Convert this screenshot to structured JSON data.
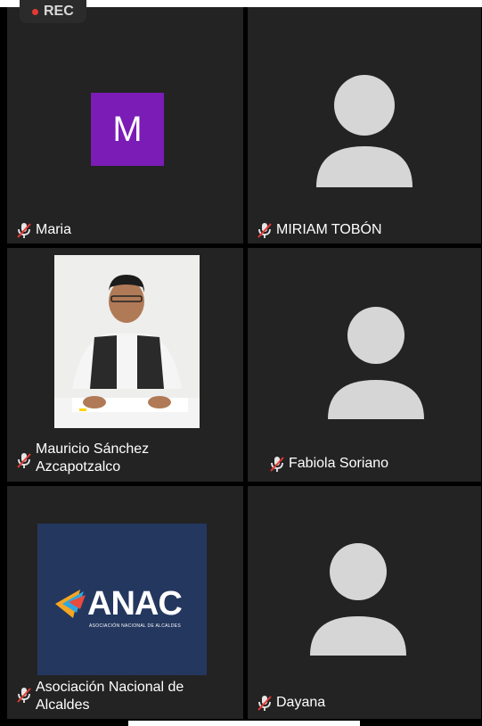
{
  "recording": {
    "label": "REC"
  },
  "participants": [
    {
      "name": "Maria",
      "avatar_letter": "M",
      "avatar_color": "#7a1cb5",
      "muted": true
    },
    {
      "name": "MIRIAM TOBÓN",
      "muted": true
    },
    {
      "name_line1": "Mauricio Sánchez",
      "name_line2": "Azcapotzalco",
      "muted": true
    },
    {
      "name": "Fabiola Soriano",
      "muted": true
    },
    {
      "name_line1": "Asociación Nacional de",
      "name_line2": "Alcaldes",
      "muted": true,
      "logo_text": "ANAC",
      "logo_subtext": "ASOCIACIÓN NACIONAL DE ALCALDES"
    },
    {
      "name": "Dayana",
      "muted": true
    }
  ],
  "colors": {
    "tile": "#232323",
    "mute": "#e53935",
    "placeholder": "#d6d6d6"
  }
}
